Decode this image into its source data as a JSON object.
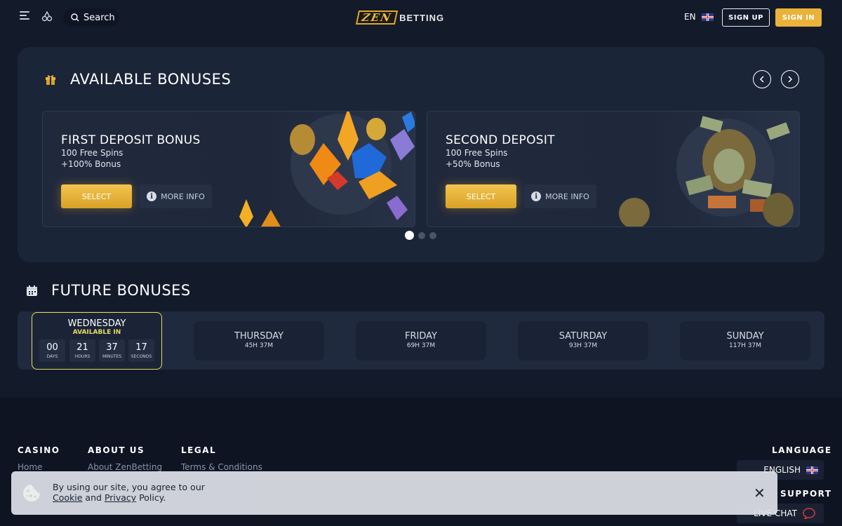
{
  "header": {
    "search_label": "Search",
    "logo_zen": "ZEN",
    "logo_betting": "BETTING",
    "language": "EN",
    "signup_label": "SIGN UP",
    "signin_label": "SIGN IN"
  },
  "available": {
    "title": "AVAILABLE BONUSES",
    "cards": [
      {
        "title": "FIRST DEPOSIT BONUS",
        "line1": "100 Free Spins",
        "line2": "+100% Bonus",
        "select_label": "SELECT",
        "more_label": "MORE INFO"
      },
      {
        "title": "SECOND DEPOSIT",
        "line1": "100 Free Spins",
        "line2": "+50% Bonus",
        "select_label": "SELECT",
        "more_label": "MORE INFO"
      }
    ],
    "info_glyph": "i",
    "active_slide": 1,
    "slide_count": 3
  },
  "future": {
    "title": "FUTURE BONUSES",
    "active_day": {
      "name": "WEDNESDAY",
      "status": "AVAILABLE IN",
      "countdown": [
        {
          "value": "00",
          "unit": "DAYS"
        },
        {
          "value": "21",
          "unit": "HOURS"
        },
        {
          "value": "37",
          "unit": "MINUTES"
        },
        {
          "value": "17",
          "unit": "SECONDS"
        }
      ]
    },
    "days": [
      {
        "name": "THURSDAY",
        "time": "45H 37M"
      },
      {
        "name": "FRIDAY",
        "time": "69H 37M"
      },
      {
        "name": "SATURDAY",
        "time": "93H 37M"
      },
      {
        "name": "SUNDAY",
        "time": "117H 37M"
      }
    ]
  },
  "footer": {
    "casino_heading": "CASINO",
    "casino_link": "Home",
    "about_heading": "ABOUT US",
    "about_link": "About ZenBetting",
    "legal_heading": "LEGAL",
    "legal_link": "Terms & Conditions",
    "language_heading": "LANGUAGE",
    "language_value": "ENGLISH",
    "support_heading": "SUPPORT",
    "livechat_label": "LIVE CHAT"
  },
  "cookie": {
    "line1": "By using our site, you agree to our",
    "cookie_link": "Cookie",
    "and": "and",
    "privacy_link": "Privacy",
    "policy": "Policy.",
    "close_glyph": "✕"
  },
  "colors": {
    "background": "#131a2a",
    "panel": "#1b2538",
    "accent_gold": "#e9b23a",
    "active_day_border": "#e7dc62"
  }
}
